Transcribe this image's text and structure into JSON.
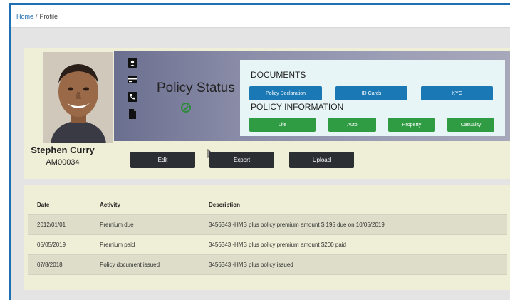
{
  "breadcrumb": {
    "home": "Home",
    "separator": "/",
    "current": "Profile"
  },
  "profile": {
    "name": "Stephen Curry",
    "id": "AM00034"
  },
  "banner": {
    "title": "Policy Status",
    "side_icons": [
      "contact-card-icon",
      "credit-card-icon",
      "phone-icon",
      "document-icon"
    ],
    "status_icon": "check-circle-icon",
    "status_color": "#2e8b3a"
  },
  "documents": {
    "heading": "DOCUMENTS",
    "buttons": [
      "Policy Declaration",
      "ID Cards",
      "KYC"
    ]
  },
  "policy_info": {
    "heading": "POLICY INFORMATION",
    "buttons": [
      "Life",
      "Auto",
      "Property",
      "Casuality"
    ]
  },
  "actions": {
    "edit": "Edit",
    "export": "Export",
    "upload": "Upload"
  },
  "activity_table": {
    "columns": [
      "Date",
      "Activity",
      "Description"
    ],
    "rows": [
      [
        "2012/01/01",
        "Premium due",
        "3456343 -HMS plus policy premium amount $ 195 due on 10/05/2019"
      ],
      [
        "05/05/2019",
        "Premium paid",
        "3456343 -HMS plus policy premium amount $200 paid"
      ],
      [
        "07/8/2018",
        "Policy document issued",
        "3456343 -HMS plus policy issued"
      ]
    ]
  },
  "colors": {
    "accent_blue": "#1a78b5",
    "accent_green": "#2f9c43",
    "dark_button": "#2b2e33",
    "card_bg": "#efeed6"
  }
}
